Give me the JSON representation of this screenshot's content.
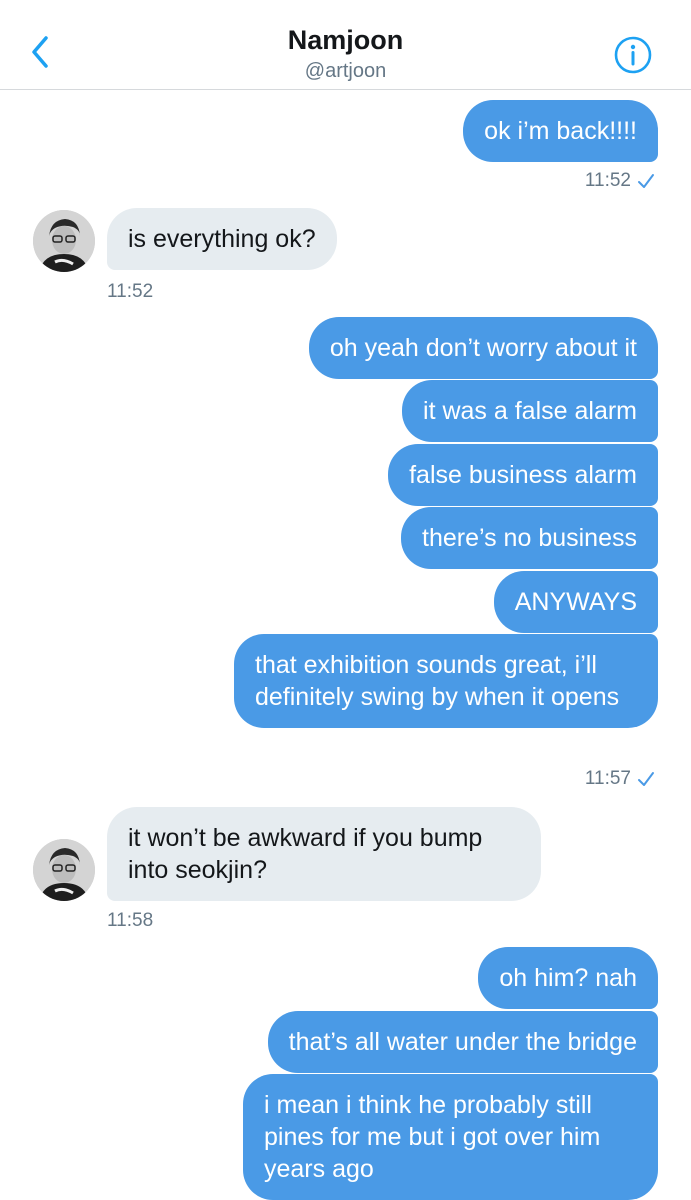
{
  "header": {
    "name": "Namjoon",
    "handle": "@artjoon"
  },
  "colors": {
    "accent": "#1da1f2",
    "outgoing_bubble": "#4a9ae6",
    "incoming_bubble": "#e6ecf0",
    "timestamp": "#657786"
  },
  "icons": {
    "back": "chevron-left-icon",
    "info": "info-circle-icon",
    "read_receipt": "checkmark-icon"
  },
  "messages": [
    {
      "from": "me",
      "text": "ok i’m back!!!!"
    },
    {
      "timestamp": "11:52"
    },
    {
      "from": "them",
      "text": "is everything ok?"
    },
    {
      "timestamp": "11:52"
    },
    {
      "from": "me",
      "text": "oh yeah don’t worry about it"
    },
    {
      "from": "me",
      "text": "it was a false alarm"
    },
    {
      "from": "me",
      "text": "false business alarm"
    },
    {
      "from": "me",
      "text": "there’s no business"
    },
    {
      "from": "me",
      "text": "ANYWAYS"
    },
    {
      "from": "me",
      "text": "that exhibition sounds great, i’ll definitely swing by when it opens"
    },
    {
      "timestamp": "11:57"
    },
    {
      "from": "them",
      "text": "it won’t be awkward if you bump into seokjin?"
    },
    {
      "timestamp": "11:58"
    },
    {
      "from": "me",
      "text": "oh him? nah"
    },
    {
      "from": "me",
      "text": "that’s all water under the bridge"
    },
    {
      "from": "me",
      "text": "i mean i think he probably still pines for me but i got over him years ago"
    }
  ]
}
